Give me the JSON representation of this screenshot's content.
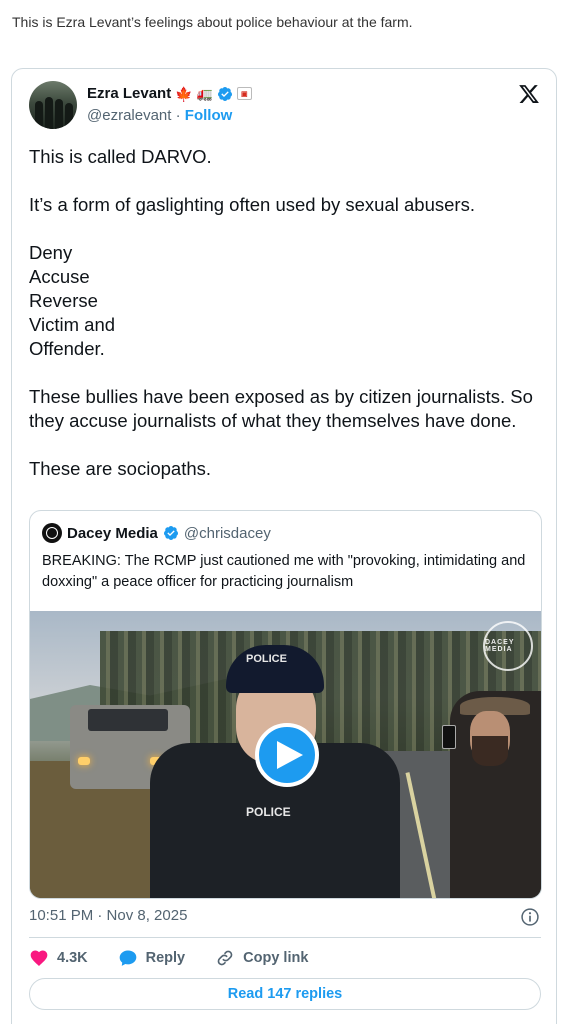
{
  "intro_text": "This is Ezra Levant’s feelings about police behaviour at the farm.",
  "tweet": {
    "author_name": "Ezra Levant",
    "author_handle": "@ezralevant",
    "separator": "·",
    "follow_label": "Follow",
    "paragraphs": [
      "This is called DARVO.",
      "It’s a form of gaslighting often used by sexual abusers.",
      "Deny\nAccuse\nReverse\nVictim and\nOffender.",
      "These bullies have been exposed as by citizen journalists. So they accuse journalists of what they themselves have done.",
      "These are sociopaths."
    ],
    "timestamp": "10:51 PM · Nov 8, 2025",
    "like_count": "4.3K",
    "reply_label": "Reply",
    "copy_link_label": "Copy link",
    "read_replies_label": "Read 147 replies"
  },
  "quoted_tweet": {
    "author_name": "Dacey Media",
    "author_handle": "@chrisdacey",
    "text": "BREAKING: The RCMP just cautioned me with \"provoking, intimidating and doxxing\" a peace officer for practicing journalism",
    "video_cap_text": "POLICE",
    "video_vest_text": "POLICE",
    "video_logo_text": "DACEY MEDIA"
  },
  "icons": {
    "platform": "x-logo-icon",
    "verified": "verified-badge-icon",
    "flag": "canada-flag-icon",
    "truck": "truck-icon",
    "play": "play-icon",
    "info": "info-icon",
    "like": "heart-icon",
    "reply": "speech-bubble-icon",
    "copy": "link-icon"
  },
  "colors": {
    "accent": "#1d9bf0",
    "like": "#f91880",
    "text_secondary": "#536471",
    "border": "#cfd9de"
  }
}
